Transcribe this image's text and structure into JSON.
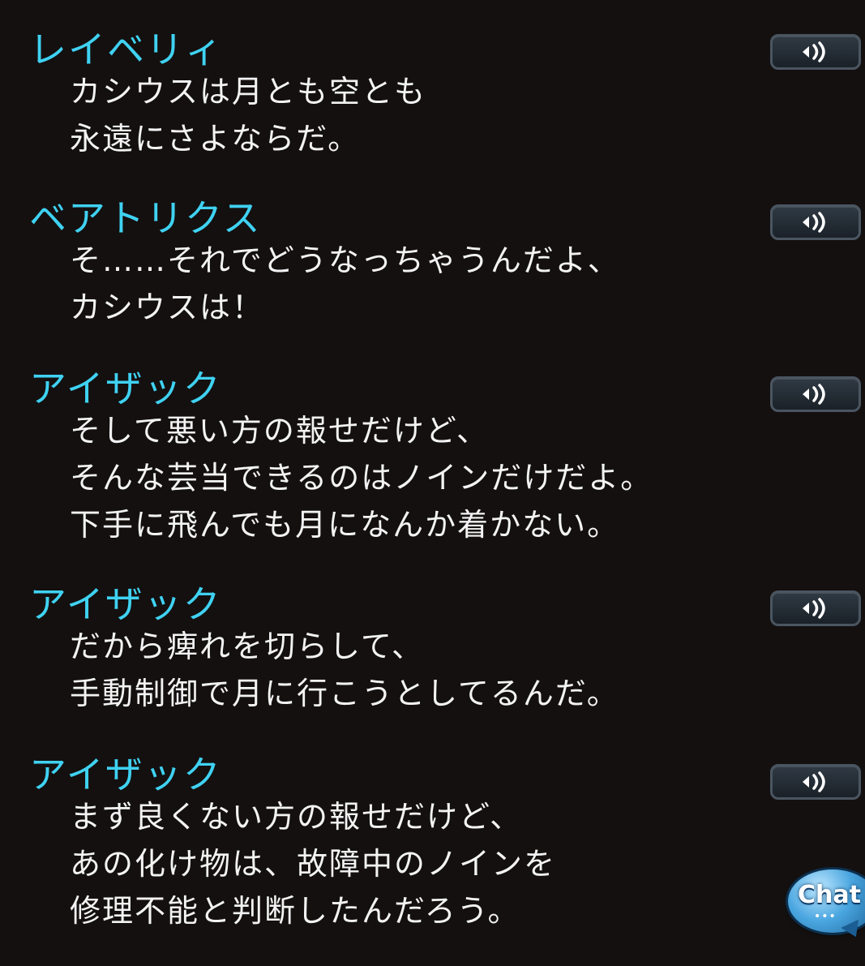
{
  "entries": [
    {
      "speaker": "レイベリィ",
      "lines": [
        "カシウスは月とも空とも",
        "永遠にさよならだ。"
      ]
    },
    {
      "speaker": "ベアトリクス",
      "lines": [
        "そ……それでどうなっちゃうんだよ、",
        "カシウスは！"
      ]
    },
    {
      "speaker": "アイザック",
      "lines": [
        "そして悪い方の報せだけど、",
        "そんな芸当できるのはノインだけだよ。",
        "下手に飛んでも月になんか着かない。"
      ]
    },
    {
      "speaker": "アイザック",
      "lines": [
        "だから痺れを切らして、",
        "手動制御で月に行こうとしてるんだ。"
      ]
    },
    {
      "speaker": "アイザック",
      "lines": [
        "まず良くない方の報せだけど、",
        "あの化け物は、故障中のノインを",
        "修理不能と判断したんだろう。"
      ]
    }
  ],
  "voice_button": {
    "icon": "speaker-icon"
  },
  "chat_button": {
    "label": "Chat",
    "dots": "•••",
    "icon": "chat-bubble-icon"
  },
  "colors": {
    "background": "#141010",
    "speaker_name": "#3fd2f2",
    "dialogue_text": "#f3f3f3"
  }
}
